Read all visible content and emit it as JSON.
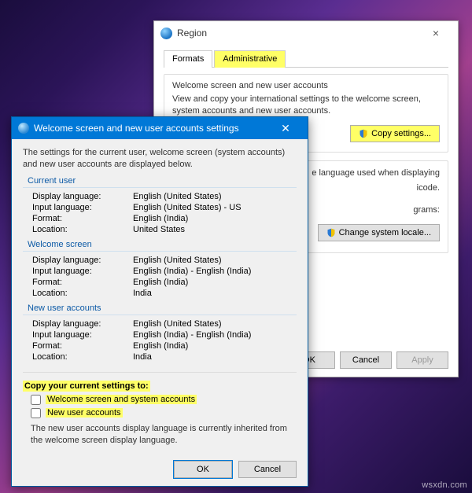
{
  "region": {
    "title": "Region",
    "tabs": {
      "formats": "Formats",
      "administrative": "Administrative"
    },
    "welcome_group": {
      "title": "Welcome screen and new user accounts",
      "desc": "View and copy your international settings to the welcome screen, system accounts and new user accounts.",
      "copy_btn": "Copy settings..."
    },
    "lang_group": {
      "desc_partial1": "e language used when displaying",
      "desc_partial2": "icode.",
      "desc_partial3": "grams:",
      "locale_btn": "Change system locale..."
    },
    "buttons": {
      "ok": "OK",
      "cancel": "Cancel",
      "apply": "Apply"
    }
  },
  "welcome": {
    "title": "Welcome screen and new user accounts settings",
    "intro": "The settings for the current user, welcome screen (system accounts) and new user accounts are displayed below.",
    "sections": {
      "current_user": {
        "heading": "Current user",
        "display_language_k": "Display language:",
        "display_language_v": "English (United States)",
        "input_language_k": "Input language:",
        "input_language_v": "English (United States) - US",
        "format_k": "Format:",
        "format_v": "English (India)",
        "location_k": "Location:",
        "location_v": "United States"
      },
      "welcome_screen": {
        "heading": "Welcome screen",
        "display_language_k": "Display language:",
        "display_language_v": "English (United States)",
        "input_language_k": "Input language:",
        "input_language_v": "English (India) - English (India)",
        "format_k": "Format:",
        "format_v": "English (India)",
        "location_k": "Location:",
        "location_v": "India"
      },
      "new_user": {
        "heading": "New user accounts",
        "display_language_k": "Display language:",
        "display_language_v": "English (United States)",
        "input_language_k": "Input language:",
        "input_language_v": "English (India) - English (India)",
        "format_k": "Format:",
        "format_v": "English (India)",
        "location_k": "Location:",
        "location_v": "India"
      }
    },
    "copy": {
      "title": "Copy your current settings to:",
      "chk1": "Welcome screen and system accounts",
      "chk2": "New user accounts",
      "note": "The new user accounts display language is currently inherited from the welcome screen display language."
    },
    "buttons": {
      "ok": "OK",
      "cancel": "Cancel"
    }
  },
  "shield_svg": true,
  "watermark": "wsxdn.com"
}
